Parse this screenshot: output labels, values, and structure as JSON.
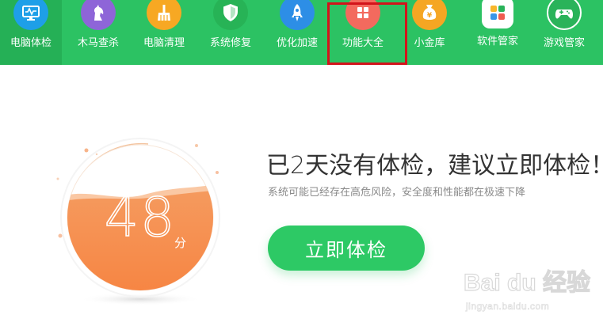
{
  "nav": {
    "items": [
      {
        "label": "电脑体检",
        "icon": "monitor-icon",
        "color": "#1e9fe8",
        "active": true
      },
      {
        "label": "木马查杀",
        "icon": "horse-icon",
        "color": "#8e65d8"
      },
      {
        "label": "电脑清理",
        "icon": "broom-icon",
        "color": "#f7a823"
      },
      {
        "label": "系统修复",
        "icon": "shield-icon",
        "color": "#27b356"
      },
      {
        "label": "优化加速",
        "icon": "rocket-icon",
        "color": "#2d8ee6"
      },
      {
        "label": "功能大全",
        "icon": "grid-icon",
        "color": "#f36a5e",
        "highlighted": true
      },
      {
        "label": "小金库",
        "icon": "coin-bag-icon",
        "color": "#f5a623"
      },
      {
        "label": "软件管家",
        "icon": "app-store-icon",
        "color": "#ffffff"
      },
      {
        "label": "游戏管家",
        "icon": "gamepad-icon",
        "color": "#2ab35a"
      }
    ]
  },
  "score": {
    "value": "48",
    "unit": "分",
    "fill_level": 0.55,
    "color": "#f7884a"
  },
  "main": {
    "headline": "已2天没有体检，建议立即体检！",
    "subline": "系统可能已经存在高危风险，安全度和性能都在极速下降",
    "button_label": "立即体检"
  },
  "watermark": {
    "text": "Bai du 经验",
    "url": "jingyan.baidu.com"
  },
  "colors": {
    "topbar": "#2cc263",
    "button": "#2dc965",
    "highlight_border": "#d3131b"
  }
}
